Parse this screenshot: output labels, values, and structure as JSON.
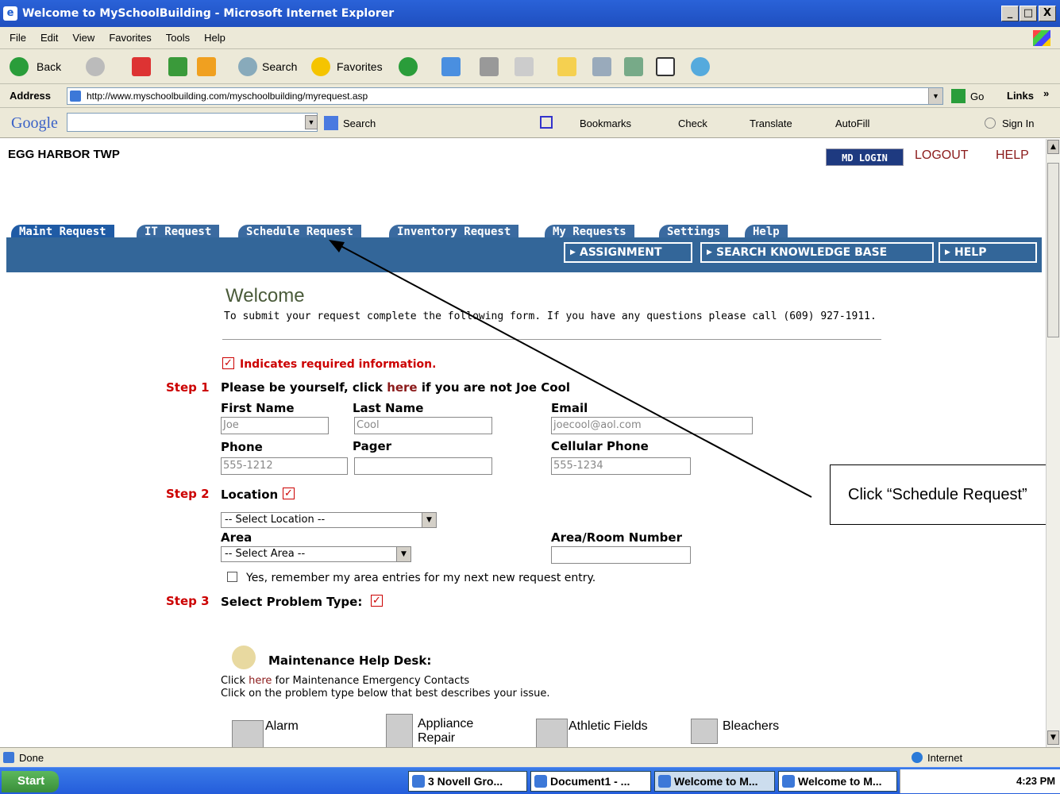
{
  "window": {
    "title": "Welcome to MySchoolBuilding - Microsoft Internet Explorer",
    "min": "_",
    "max": "□",
    "close": "X"
  },
  "menu": [
    "File",
    "Edit",
    "View",
    "Favorites",
    "Tools",
    "Help"
  ],
  "toolbar": {
    "back": "Back",
    "search": "Search",
    "favorites": "Favorites"
  },
  "address": {
    "label": "Address",
    "url": "http://www.myschoolbuilding.com/myschoolbuilding/myrequest.asp",
    "go": "Go",
    "links": "Links"
  },
  "googlebar": {
    "logo": "Google",
    "search": "Search",
    "bookmarks": "Bookmarks",
    "check": "Check",
    "translate": "Translate",
    "autofill": "AutoFill",
    "signin": "Sign In"
  },
  "page": {
    "org": "EGG HARBOR TWP",
    "md_login": "MD LOGIN",
    "logout": "LOGOUT",
    "help": "HELP",
    "tabs": [
      "Maint Request",
      "IT Request",
      "Schedule Request",
      "Inventory Request",
      "My Requests",
      "Settings",
      "Help"
    ],
    "blue_buttons": [
      "ASSIGNMENT",
      "SEARCH KNOWLEDGE BASE",
      "HELP"
    ],
    "welcome": "Welcome",
    "intro": "To submit your request complete the following form. If you have any questions please call (609) 927-1911.",
    "required_note": "Indicates required information.",
    "step1": {
      "label": "Step 1",
      "text_a": "Please be yourself, click ",
      "link": "here",
      "text_b": " if you are not Joe Cool"
    },
    "fields": {
      "first_name": {
        "label": "First Name",
        "value": "Joe"
      },
      "last_name": {
        "label": "Last Name",
        "value": "Cool"
      },
      "email": {
        "label": "Email",
        "value": "joecool@aol.com"
      },
      "phone": {
        "label": "Phone",
        "value": "555-1212"
      },
      "pager": {
        "label": "Pager",
        "value": ""
      },
      "cell": {
        "label": "Cellular Phone",
        "value": "555-1234"
      }
    },
    "step2": {
      "label": "Step 2",
      "text": "Location"
    },
    "location_select": "-- Select Location --",
    "area_label": "Area",
    "area_select": "-- Select Area --",
    "room_label": "Area/Room Number",
    "remember": "Yes, remember my area entries for my next new request entry.",
    "step3": {
      "label": "Step 3",
      "text": "Select Problem Type:"
    },
    "helpdesk": "Maintenance Help Desk:",
    "contacts_a": "Click ",
    "contacts_link": "here",
    "contacts_b": " for Maintenance Emergency Contacts",
    "describe": "Click on the problem type below that best describes your issue.",
    "categories": [
      "Alarm",
      "Appliance Repair",
      "Athletic Fields",
      "Bleachers"
    ],
    "callout": "Click “Schedule Request”"
  },
  "status": {
    "text": "Done",
    "zone": "Internet"
  },
  "taskbar": {
    "start": "Start",
    "tasks": [
      "3 Novell Gro...",
      "Document1 - ...",
      "Welcome to M...",
      "Welcome to M..."
    ],
    "time": "4:23 PM"
  }
}
